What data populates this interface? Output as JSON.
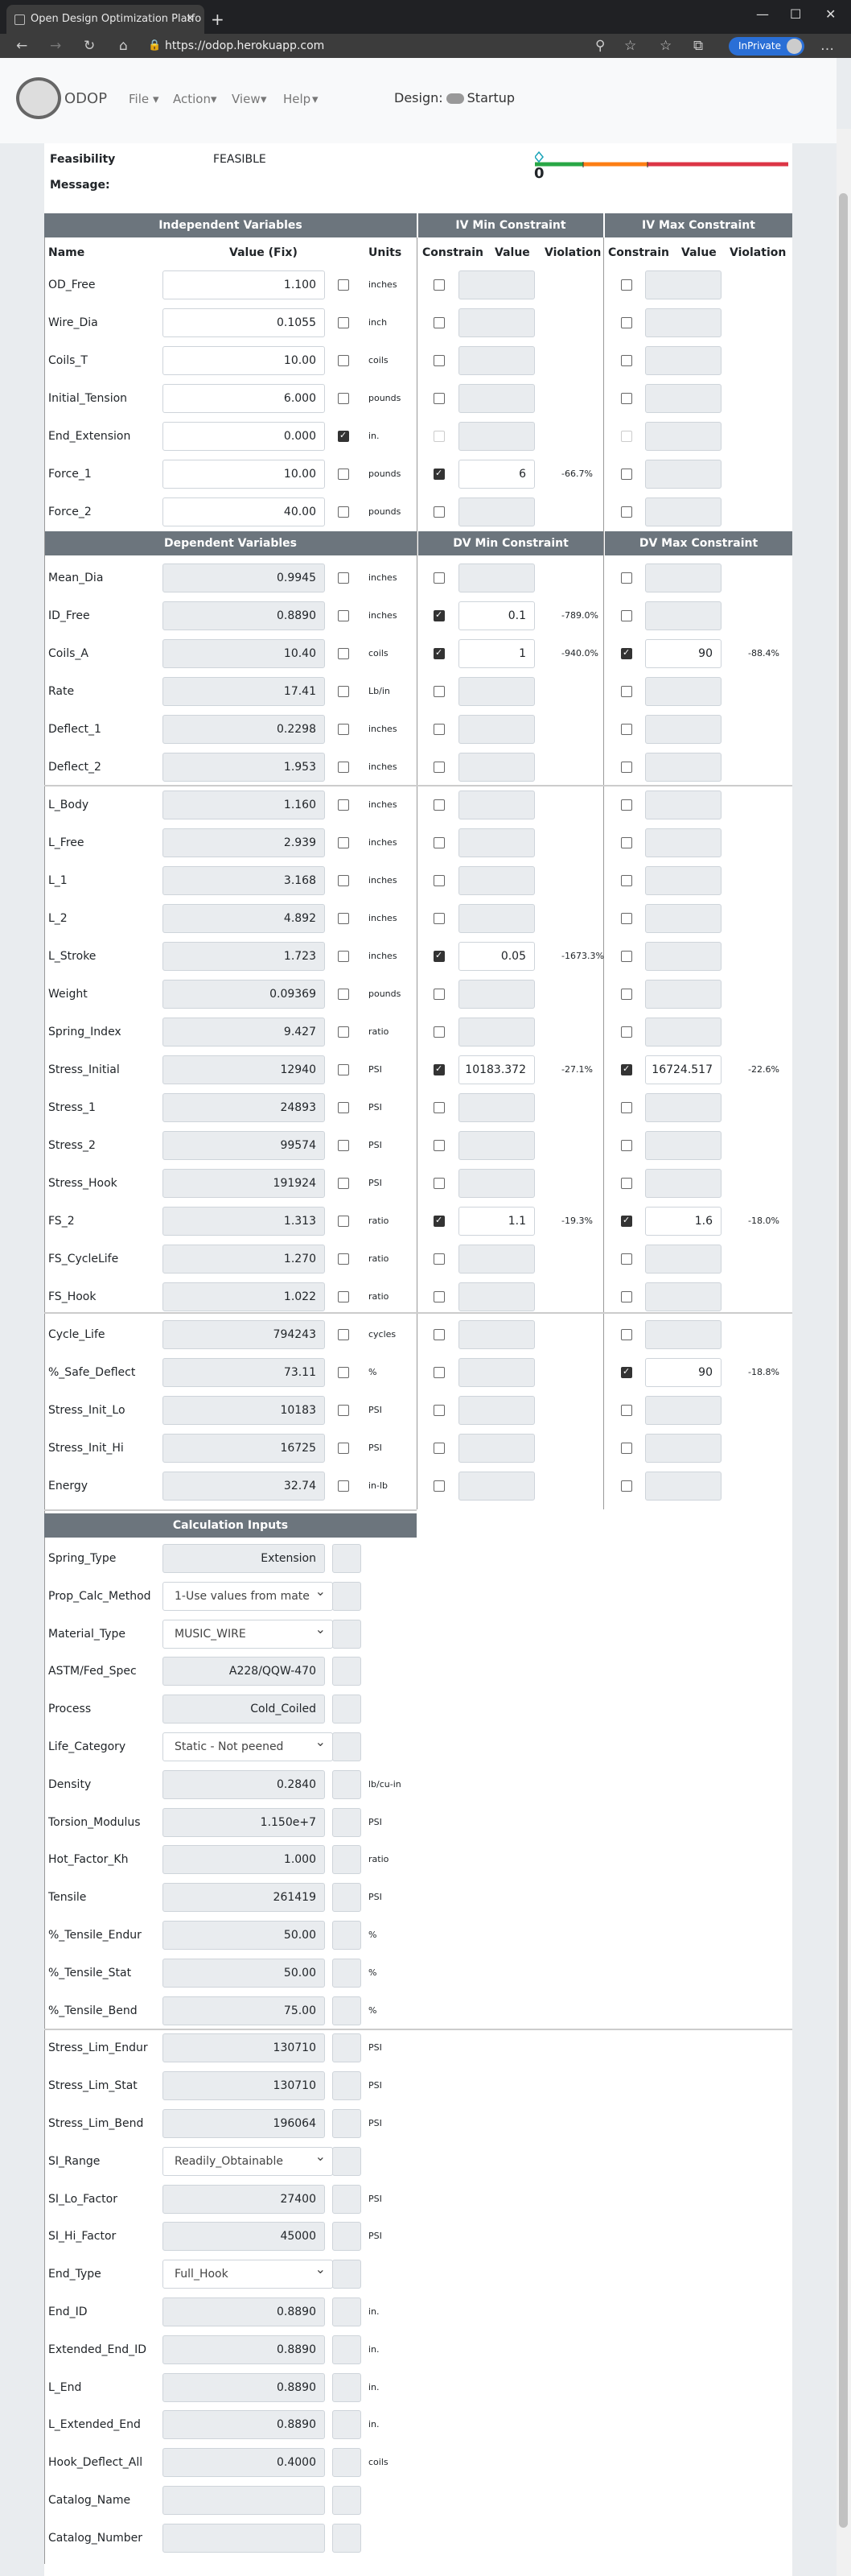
{
  "browser": {
    "tab_title": "Open Design Optimization Platfo",
    "url": "https://odop.herokuapp.com",
    "inprivate": "InPrivate"
  },
  "app": {
    "logo": "ODOP",
    "menus": [
      "File",
      "Action",
      "View",
      "Help"
    ],
    "design_label": "Design:",
    "design_name": "Startup"
  },
  "status": {
    "feasibility_label": "Feasibility",
    "feasibility_value": "FEASIBLE",
    "message_label": "Message:",
    "bar_zero": "0"
  },
  "headers": {
    "iv": "Independent Variables",
    "iv_min": "IV Min Constraint",
    "iv_max": "IV Max Constraint",
    "dv": "Dependent Variables",
    "dv_min": "DV Min Constraint",
    "dv_max": "DV Max Constraint",
    "calc": "Calculation Inputs",
    "name": "Name",
    "value_fix": "Value (Fix)",
    "units": "Units",
    "constrain": "Constrain",
    "value": "Value",
    "violation": "Violation"
  },
  "iv_rows": [
    {
      "name": "OD_Free",
      "value": "1.100",
      "fix": false,
      "units": "inches",
      "min_on": false,
      "min_val": "",
      "min_viol": "",
      "max_on": false,
      "max_val": "",
      "max_viol": ""
    },
    {
      "name": "Wire_Dia",
      "value": "0.1055",
      "fix": false,
      "units": "inch",
      "min_on": false,
      "min_val": "",
      "min_viol": "",
      "max_on": false,
      "max_val": "",
      "max_viol": ""
    },
    {
      "name": "Coils_T",
      "value": "10.00",
      "fix": false,
      "units": "coils",
      "min_on": false,
      "min_val": "",
      "min_viol": "",
      "max_on": false,
      "max_val": "",
      "max_viol": ""
    },
    {
      "name": "Initial_Tension",
      "value": "6.000",
      "fix": false,
      "units": "pounds",
      "min_on": false,
      "min_val": "",
      "min_viol": "",
      "max_on": false,
      "max_val": "",
      "max_viol": ""
    },
    {
      "name": "End_Extension",
      "value": "0.000",
      "fix": true,
      "units": "in.",
      "min_on": false,
      "min_val": "",
      "min_viol": "",
      "max_on": false,
      "max_val": "",
      "max_viol": ""
    },
    {
      "name": "Force_1",
      "value": "10.00",
      "fix": false,
      "units": "pounds",
      "min_on": true,
      "min_val": "6",
      "min_viol": "-66.7%",
      "max_on": false,
      "max_val": "",
      "max_viol": ""
    },
    {
      "name": "Force_2",
      "value": "40.00",
      "fix": false,
      "units": "pounds",
      "min_on": false,
      "min_val": "",
      "min_viol": "",
      "max_on": false,
      "max_val": "",
      "max_viol": ""
    }
  ],
  "dv_rows": [
    {
      "name": "Mean_Dia",
      "value": "0.9945",
      "units": "inches",
      "min_on": false,
      "min_val": "",
      "min_viol": "",
      "max_on": false,
      "max_val": "",
      "max_viol": ""
    },
    {
      "name": "ID_Free",
      "value": "0.8890",
      "units": "inches",
      "min_on": true,
      "min_val": "0.1",
      "min_viol": "-789.0%",
      "max_on": false,
      "max_val": "",
      "max_viol": ""
    },
    {
      "name": "Coils_A",
      "value": "10.40",
      "units": "coils",
      "min_on": true,
      "min_val": "1",
      "min_viol": "-940.0%",
      "max_on": true,
      "max_val": "90",
      "max_viol": "-88.4%"
    },
    {
      "name": "Rate",
      "value": "17.41",
      "units": "Lb/in",
      "min_on": false,
      "min_val": "",
      "min_viol": "",
      "max_on": false,
      "max_val": "",
      "max_viol": ""
    },
    {
      "name": "Deflect_1",
      "value": "0.2298",
      "units": "inches",
      "min_on": false,
      "min_val": "",
      "min_viol": "",
      "max_on": false,
      "max_val": "",
      "max_viol": ""
    },
    {
      "name": "Deflect_2",
      "value": "1.953",
      "units": "inches",
      "min_on": false,
      "min_val": "",
      "min_viol": "",
      "max_on": false,
      "max_val": "",
      "max_viol": ""
    },
    {
      "name": "L_Body",
      "value": "1.160",
      "units": "inches",
      "min_on": false,
      "min_val": "",
      "min_viol": "",
      "max_on": false,
      "max_val": "",
      "max_viol": ""
    },
    {
      "name": "L_Free",
      "value": "2.939",
      "units": "inches",
      "min_on": false,
      "min_val": "",
      "min_viol": "",
      "max_on": false,
      "max_val": "",
      "max_viol": ""
    },
    {
      "name": "L_1",
      "value": "3.168",
      "units": "inches",
      "min_on": false,
      "min_val": "",
      "min_viol": "",
      "max_on": false,
      "max_val": "",
      "max_viol": ""
    },
    {
      "name": "L_2",
      "value": "4.892",
      "units": "inches",
      "min_on": false,
      "min_val": "",
      "min_viol": "",
      "max_on": false,
      "max_val": "",
      "max_viol": ""
    },
    {
      "name": "L_Stroke",
      "value": "1.723",
      "units": "inches",
      "min_on": true,
      "min_val": "0.05",
      "min_viol": "-1673.3%",
      "max_on": false,
      "max_val": "",
      "max_viol": ""
    },
    {
      "name": "Weight",
      "value": "0.09369",
      "units": "pounds",
      "min_on": false,
      "min_val": "",
      "min_viol": "",
      "max_on": false,
      "max_val": "",
      "max_viol": ""
    },
    {
      "name": "Spring_Index",
      "value": "9.427",
      "units": "ratio",
      "min_on": false,
      "min_val": "",
      "min_viol": "",
      "max_on": false,
      "max_val": "",
      "max_viol": ""
    },
    {
      "name": "Stress_Initial",
      "value": "12940",
      "units": "PSI",
      "min_on": true,
      "min_val": "10183.372",
      "min_viol": "-27.1%",
      "max_on": true,
      "max_val": "16724.517",
      "max_viol": "-22.6%"
    },
    {
      "name": "Stress_1",
      "value": "24893",
      "units": "PSI",
      "min_on": false,
      "min_val": "",
      "min_viol": "",
      "max_on": false,
      "max_val": "",
      "max_viol": ""
    },
    {
      "name": "Stress_2",
      "value": "99574",
      "units": "PSI",
      "min_on": false,
      "min_val": "",
      "min_viol": "",
      "max_on": false,
      "max_val": "",
      "max_viol": ""
    },
    {
      "name": "Stress_Hook",
      "value": "191924",
      "units": "PSI",
      "min_on": false,
      "min_val": "",
      "min_viol": "",
      "max_on": false,
      "max_val": "",
      "max_viol": ""
    },
    {
      "name": "FS_2",
      "value": "1.313",
      "units": "ratio",
      "min_on": true,
      "min_val": "1.1",
      "min_viol": "-19.3%",
      "max_on": true,
      "max_val": "1.6",
      "max_viol": "-18.0%"
    },
    {
      "name": "FS_CycleLife",
      "value": "1.270",
      "units": "ratio",
      "min_on": false,
      "min_val": "",
      "min_viol": "",
      "max_on": false,
      "max_val": "",
      "max_viol": ""
    },
    {
      "name": "FS_Hook",
      "value": "1.022",
      "units": "ratio",
      "min_on": false,
      "min_val": "",
      "min_viol": "",
      "max_on": false,
      "max_val": "",
      "max_viol": ""
    },
    {
      "name": "Cycle_Life",
      "value": "794243",
      "units": "cycles",
      "min_on": false,
      "min_val": "",
      "min_viol": "",
      "max_on": false,
      "max_val": "",
      "max_viol": ""
    },
    {
      "name": "%_Safe_Deflect",
      "value": "73.11",
      "units": "%",
      "min_on": false,
      "min_val": "",
      "min_viol": "",
      "max_on": true,
      "max_val": "90",
      "max_viol": "-18.8%"
    },
    {
      "name": "Stress_Init_Lo",
      "value": "10183",
      "units": "PSI",
      "min_on": false,
      "min_val": "",
      "min_viol": "",
      "max_on": false,
      "max_val": "",
      "max_viol": ""
    },
    {
      "name": "Stress_Init_Hi",
      "value": "16725",
      "units": "PSI",
      "min_on": false,
      "min_val": "",
      "min_viol": "",
      "max_on": false,
      "max_val": "",
      "max_viol": ""
    },
    {
      "name": "Energy",
      "value": "32.74",
      "units": "in-lb",
      "min_on": false,
      "min_val": "",
      "min_viol": "",
      "max_on": false,
      "max_val": "",
      "max_viol": ""
    }
  ],
  "calc_rows": [
    {
      "name": "Spring_Type",
      "kind": "text",
      "value": "Extension",
      "units": ""
    },
    {
      "name": "Prop_Calc_Method",
      "kind": "select",
      "value": "1-Use values from mate",
      "units": ""
    },
    {
      "name": "Material_Type",
      "kind": "select",
      "value": "MUSIC_WIRE",
      "units": ""
    },
    {
      "name": "ASTM/Fed_Spec",
      "kind": "text",
      "value": "A228/QQW-470",
      "units": ""
    },
    {
      "name": "Process",
      "kind": "text",
      "value": "Cold_Coiled",
      "units": ""
    },
    {
      "name": "Life_Category",
      "kind": "select",
      "value": "Static - Not peened",
      "units": ""
    },
    {
      "name": "Density",
      "kind": "text",
      "value": "0.2840",
      "units": "lb/cu-in"
    },
    {
      "name": "Torsion_Modulus",
      "kind": "text",
      "value": "1.150e+7",
      "units": "PSI"
    },
    {
      "name": "Hot_Factor_Kh",
      "kind": "text",
      "value": "1.000",
      "units": "ratio"
    },
    {
      "name": "Tensile",
      "kind": "text",
      "value": "261419",
      "units": "PSI"
    },
    {
      "name": "%_Tensile_Endur",
      "kind": "text",
      "value": "50.00",
      "units": "%"
    },
    {
      "name": "%_Tensile_Stat",
      "kind": "text",
      "value": "50.00",
      "units": "%"
    },
    {
      "name": "%_Tensile_Bend",
      "kind": "text",
      "value": "75.00",
      "units": "%"
    },
    {
      "name": "Stress_Lim_Endur",
      "kind": "text",
      "value": "130710",
      "units": "PSI"
    },
    {
      "name": "Stress_Lim_Stat",
      "kind": "text",
      "value": "130710",
      "units": "PSI"
    },
    {
      "name": "Stress_Lim_Bend",
      "kind": "text",
      "value": "196064",
      "units": "PSI"
    },
    {
      "name": "SI_Range",
      "kind": "select",
      "value": "Readily_Obtainable",
      "units": ""
    },
    {
      "name": "SI_Lo_Factor",
      "kind": "text",
      "value": "27400",
      "units": "PSI"
    },
    {
      "name": "SI_Hi_Factor",
      "kind": "text",
      "value": "45000",
      "units": "PSI"
    },
    {
      "name": "End_Type",
      "kind": "select",
      "value": "Full_Hook",
      "units": ""
    },
    {
      "name": "End_ID",
      "kind": "text",
      "value": "0.8890",
      "units": "in."
    },
    {
      "name": "Extended_End_ID",
      "kind": "text",
      "value": "0.8890",
      "units": "in."
    },
    {
      "name": "L_End",
      "kind": "text",
      "value": "0.8890",
      "units": "in."
    },
    {
      "name": "L_Extended_End",
      "kind": "text",
      "value": "0.8890",
      "units": "in."
    },
    {
      "name": "Hook_Deflect_All",
      "kind": "text",
      "value": "0.4000",
      "units": "coils"
    },
    {
      "name": "Catalog_Name",
      "kind": "text",
      "value": "",
      "units": ""
    },
    {
      "name": "Catalog_Number",
      "kind": "text",
      "value": "",
      "units": ""
    }
  ],
  "colors": {
    "header_bg": "#6c757d",
    "bar_green": "#28a745",
    "bar_orange": "#fd7e14",
    "bar_red": "#dc3545",
    "marker": "#17a2b8"
  }
}
